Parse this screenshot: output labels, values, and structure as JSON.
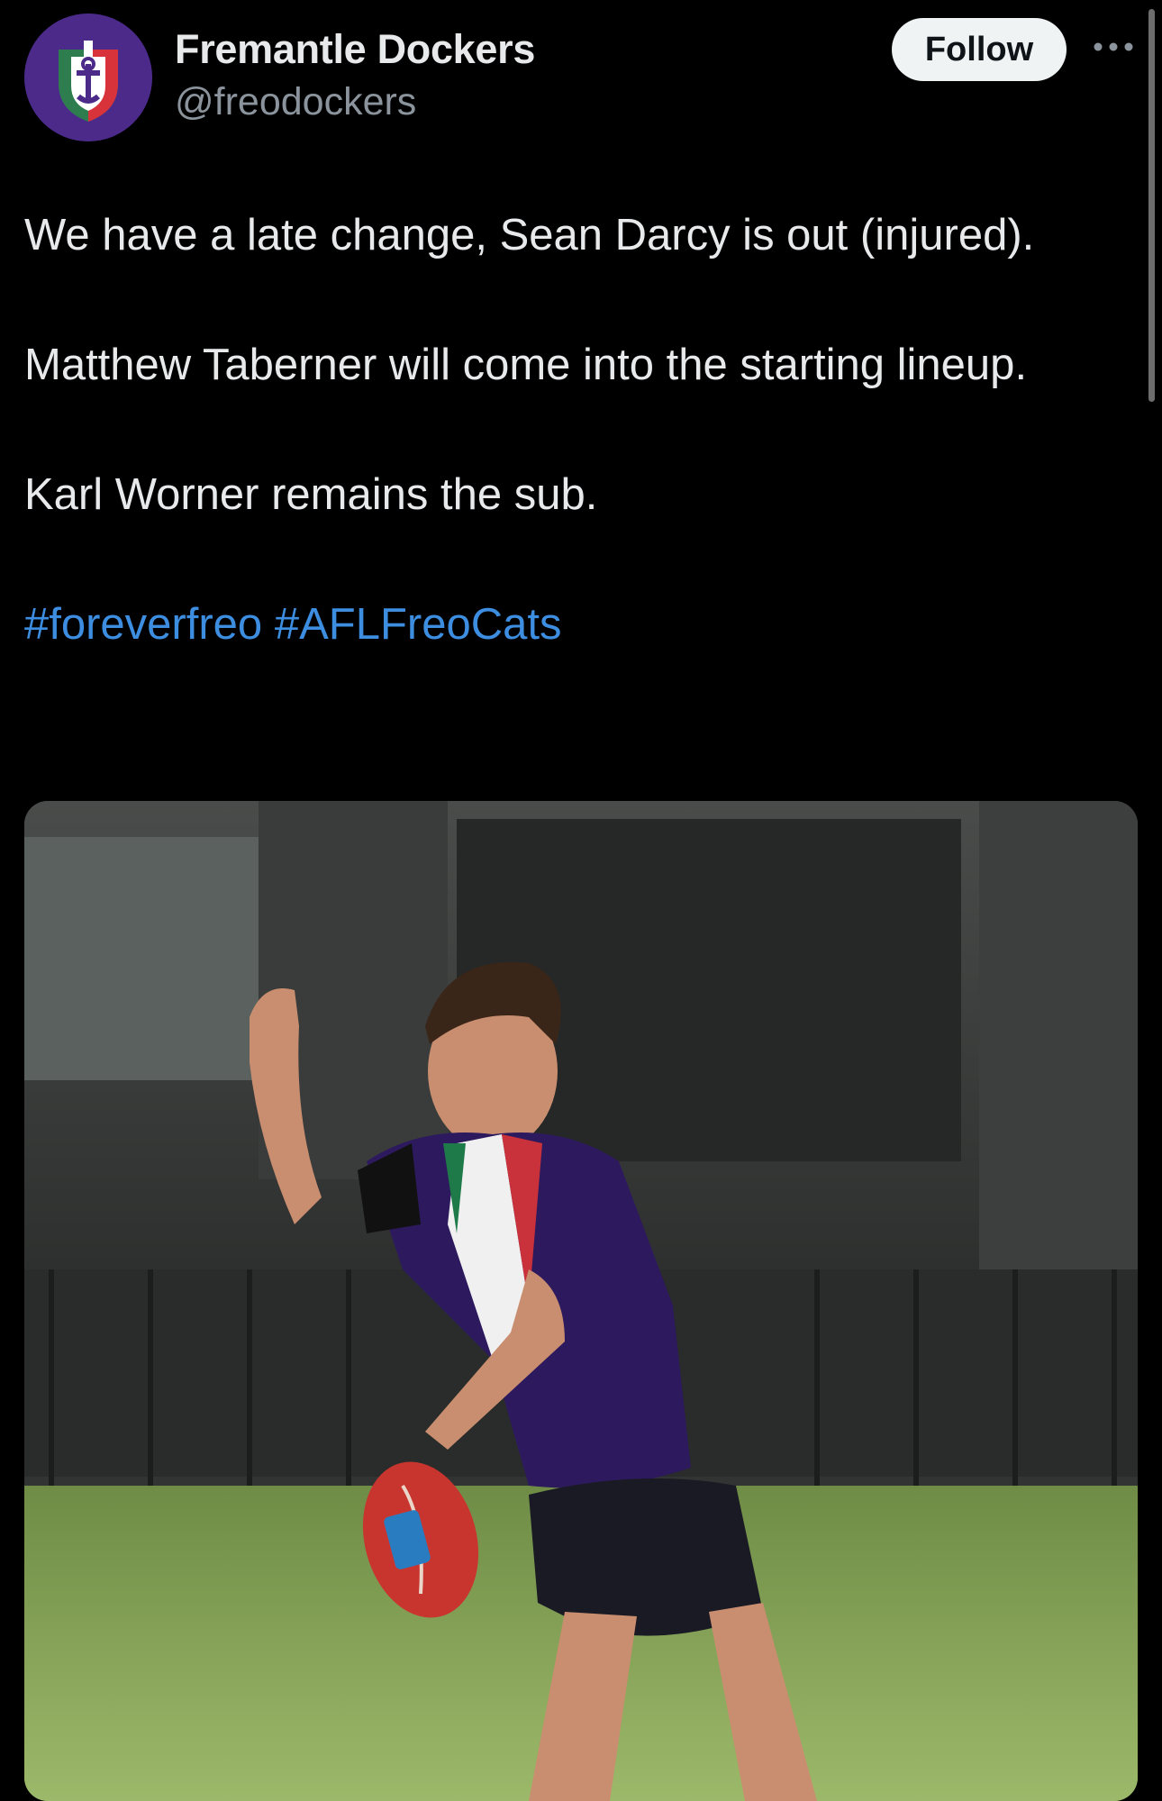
{
  "account": {
    "display_name": "Fremantle Dockers",
    "handle": "@freodockers",
    "avatar_icon": "fremantle-dockers-logo-icon"
  },
  "actions": {
    "follow_label": "Follow",
    "more_icon": "more-options-icon"
  },
  "tweet": {
    "paragraphs": [
      "We have a late change, Sean Darcy is out (injured).",
      "Matthew Taberner will come into the starting lineup.",
      "Karl Worner remains the sub."
    ],
    "hashtags": [
      "#foreverfreo",
      "#AFLFreoCats"
    ]
  },
  "media": {
    "description_icon": "player-kicking-photo"
  },
  "colors": {
    "background": "#000000",
    "text": "#e7e9ea",
    "secondary_text": "#8b949c",
    "hashtag": "#3d8ee0",
    "follow_button_bg": "#eff3f4",
    "brand_purple": "#4b2a8a"
  }
}
